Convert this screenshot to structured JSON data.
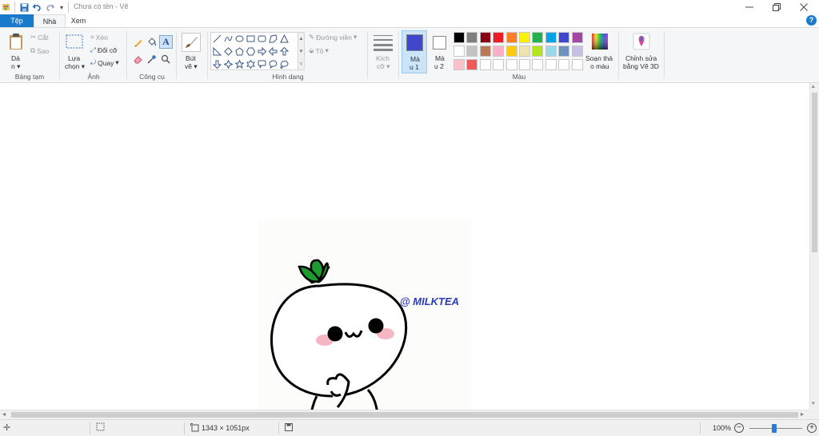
{
  "window": {
    "title": "Chưa có tên - Vẽ"
  },
  "tabs": {
    "file": "Tệp",
    "home": "Nhà",
    "view": "Xem"
  },
  "help": "?",
  "ribbon": {
    "clipboard": {
      "label": "Bảng tạm",
      "paste_l1": "Dá",
      "paste_l2": "n",
      "cut": "Cắt",
      "copy": "Sao"
    },
    "image": {
      "label": "Ảnh",
      "select_l1": "Lựa",
      "select_l2": "chọn",
      "crop": "Xén",
      "resize": "Đổi cỡ",
      "rotate": "Quay"
    },
    "tools": {
      "label": "Công cụ"
    },
    "brushes": {
      "l1": "Bút",
      "l2": "vẽ"
    },
    "shapes": {
      "label": "Hình dạng",
      "outline": "Đường viền",
      "fill": "Tô"
    },
    "size": {
      "l1": "Kích",
      "l2": "cỡ"
    },
    "color1": {
      "l1": "Mà",
      "l2": "u 1"
    },
    "color2": {
      "l1": "Mà",
      "l2": "u 2"
    },
    "colors": {
      "label": "Màu",
      "active_color1": "#3f48cc",
      "row1": [
        "#000000",
        "#7f7f7f",
        "#880015",
        "#ed1c24",
        "#ff7f27",
        "#fff200",
        "#22b14c",
        "#00a2e8",
        "#3f48cc",
        "#a349a4"
      ],
      "row2": [
        "#ffffff",
        "#c3c3c3",
        "#b97a57",
        "#ffaec9",
        "#ffc90e",
        "#efe4b0",
        "#b5e61d",
        "#99d9ea",
        "#7092be",
        "#c8bfe7"
      ],
      "row3": [
        "#ffc0cb",
        "#f05a5a",
        "#ffffff",
        "#ffffff",
        "#ffffff",
        "#ffffff",
        "#ffffff",
        "#ffffff",
        "#ffffff",
        "#ffffff"
      ]
    },
    "edit_colors": {
      "l1": "Soạn thả",
      "l2": "o màu"
    },
    "paint3d": {
      "l1": "Chỉnh sửa",
      "l2": "bằng Vẽ 3D"
    }
  },
  "canvas": {
    "watermark": "@ MILKTEA"
  },
  "status": {
    "dimensions": "1343 × 1051px",
    "zoom": "100%"
  }
}
